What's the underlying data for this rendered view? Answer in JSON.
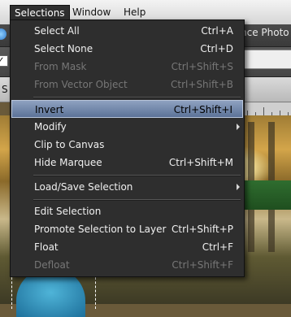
{
  "menubar": {
    "items": [
      {
        "label": "Selections",
        "open": true
      },
      {
        "label": "Window"
      },
      {
        "label": "Help"
      }
    ]
  },
  "background": {
    "photo_label": "nce Photo",
    "tab_text": "S",
    "checkbox_mark": "✓"
  },
  "menu": {
    "items": [
      {
        "label": "Select All",
        "shortcut": "Ctrl+A",
        "disabled": false
      },
      {
        "label": "Select None",
        "shortcut": "Ctrl+D",
        "disabled": false
      },
      {
        "label": "From Mask",
        "shortcut": "Ctrl+Shift+S",
        "disabled": true
      },
      {
        "label": "From Vector Object",
        "shortcut": "Ctrl+Shift+B",
        "disabled": true
      },
      {
        "label": "Invert",
        "shortcut": "Ctrl+Shift+I",
        "disabled": false,
        "highlighted": true
      },
      {
        "label": "Modify",
        "shortcut": "",
        "submenu": true
      },
      {
        "label": "Clip to Canvas",
        "shortcut": ""
      },
      {
        "label": "Hide Marquee",
        "shortcut": "Ctrl+Shift+M"
      },
      {
        "label": "Load/Save Selection",
        "shortcut": "",
        "submenu": true
      },
      {
        "label": "Edit Selection",
        "shortcut": ""
      },
      {
        "label": "Promote Selection to Layer",
        "shortcut": "Ctrl+Shift+P"
      },
      {
        "label": "Float",
        "shortcut": "Ctrl+F"
      },
      {
        "label": "Defloat",
        "shortcut": "Ctrl+Shift+F",
        "disabled": true
      }
    ]
  },
  "colors": {
    "menu_bg": "#2e2e2e",
    "highlight": "#5c7398",
    "disabled_text": "#777777"
  }
}
